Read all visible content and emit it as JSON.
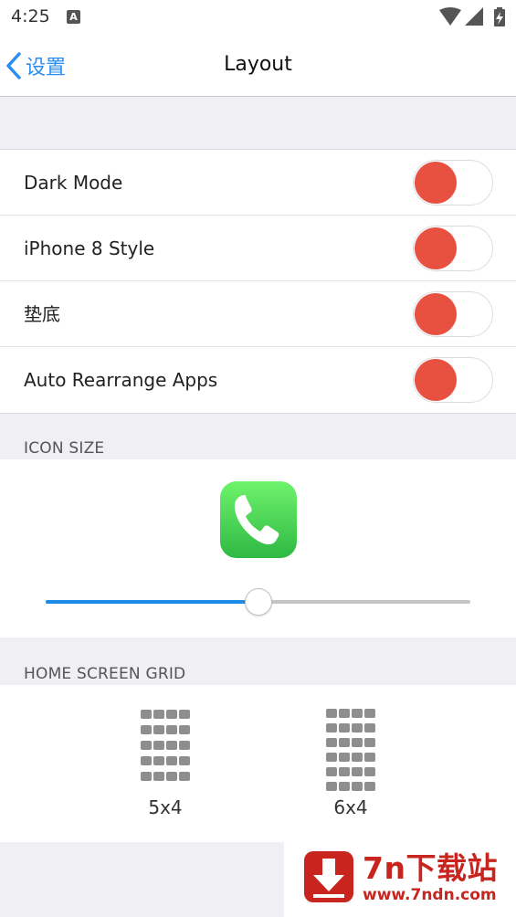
{
  "status_bar": {
    "time": "4:25",
    "notification_icon": "font-A-icon",
    "icons": [
      "wifi-icon",
      "cellular-signal-icon",
      "battery-charging-icon"
    ]
  },
  "nav": {
    "back_label": "设置",
    "back_icon": "chevron-left-icon",
    "title": "Layout"
  },
  "toggles": [
    {
      "label": "Dark Mode",
      "on": false
    },
    {
      "label": "iPhone 8 Style",
      "on": false
    },
    {
      "label": "垫底",
      "on": false
    },
    {
      "label": "Auto Rearrange Apps",
      "on": false
    }
  ],
  "icon_size": {
    "header": "ICON SIZE",
    "preview_icon": "phone-app-icon",
    "slider_value": 0.5
  },
  "home_grid": {
    "header": "HOME SCREEN GRID",
    "options": [
      {
        "label": "5x4",
        "rows": 5,
        "cols": 4
      },
      {
        "label": "6x4",
        "rows": 6,
        "cols": 4
      }
    ]
  },
  "watermark": {
    "name": "7n下载站",
    "url": "www.7ndn.com"
  },
  "colors": {
    "accent": "#2a8ef1",
    "toggle_knob": "#e8503f",
    "slider_fill": "#1c8ae6",
    "grid_cell": "#8e8e8e",
    "watermark": "#c8251f"
  }
}
